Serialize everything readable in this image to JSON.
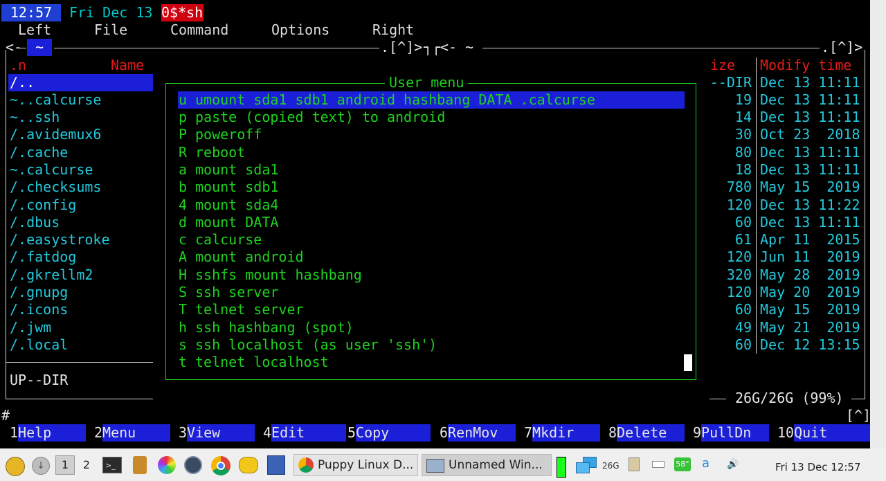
{
  "status": {
    "time": "12:57",
    "date": "Fri Dec 13",
    "session": "0$*sh"
  },
  "menubar": [
    "Left",
    "File",
    "Command",
    "Options",
    "Right"
  ],
  "left_panel": {
    "header_prefix": "<-",
    "path": "~",
    "top_right": ".[^]>",
    "col_n": ".n",
    "col_name": "Name",
    "files": [
      "/..",
      "~..calcurse",
      "~..ssh",
      "/.avidemux6",
      "/.cache",
      "~.calcurse",
      "/.checksums",
      "/.config",
      "/.dbus",
      "/.easystroke",
      "/.fatdog",
      "/.gkrellm2",
      "/.gnupg",
      "/.icons",
      "/.jwm",
      "/.local"
    ],
    "status": "UP--DIR"
  },
  "right_panel": {
    "header_left": "<- ~",
    "top_right": ".[^]>",
    "col_size": "ize",
    "col_modify": "Modify time",
    "rows": [
      {
        "size": "--DIR",
        "date": "Dec 13 11:11"
      },
      {
        "size": "19",
        "date": "Dec 13 11:11"
      },
      {
        "size": "14",
        "date": "Dec 13 11:11"
      },
      {
        "size": "30",
        "date": "Oct 23  2018"
      },
      {
        "size": "80",
        "date": "Dec 13 11:11"
      },
      {
        "size": "18",
        "date": "Dec 13 11:11"
      },
      {
        "size": "780",
        "date": "May 15  2019"
      },
      {
        "size": "120",
        "date": "Dec 13 11:22"
      },
      {
        "size": "60",
        "date": "Dec 13 11:11"
      },
      {
        "size": "61",
        "date": "Apr 11  2015"
      },
      {
        "size": "120",
        "date": "Jun 11  2019"
      },
      {
        "size": "320",
        "date": "May 28  2019"
      },
      {
        "size": "120",
        "date": "May 20  2019"
      },
      {
        "size": "60",
        "date": "May 15  2019"
      },
      {
        "size": "49",
        "date": "May 21  2019"
      },
      {
        "size": "60",
        "date": "Dec 12 13:15"
      }
    ],
    "disk": "26G/26G (99%)"
  },
  "user_menu": {
    "title": "User menu",
    "items": [
      {
        "key": "u",
        "label": "umount sda1 sdb1 android hashbang DATA .calcurse"
      },
      {
        "key": "p",
        "label": "paste (copied text) to android"
      },
      {
        "key": "P",
        "label": "poweroff"
      },
      {
        "key": "R",
        "label": "reboot"
      },
      {
        "key": "a",
        "label": "mount sda1"
      },
      {
        "key": "b",
        "label": "mount sdb1"
      },
      {
        "key": "4",
        "label": "mount sda4"
      },
      {
        "key": "d",
        "label": "mount DATA"
      },
      {
        "key": "c",
        "label": "calcurse"
      },
      {
        "key": "A",
        "label": "mount android"
      },
      {
        "key": "H",
        "label": "sshfs mount hashbang"
      },
      {
        "key": "S",
        "label": "ssh server"
      },
      {
        "key": "T",
        "label": "telnet server"
      },
      {
        "key": "h",
        "label": "ssh hashbang (spot)"
      },
      {
        "key": "s",
        "label": "ssh localhost (as user 'ssh')"
      },
      {
        "key": "t",
        "label": "telnet localhost"
      }
    ]
  },
  "prompt": "#",
  "prompt_hint": "[^]",
  "fkeys": [
    {
      "num": "1",
      "label": "Help"
    },
    {
      "num": "2",
      "label": "Menu"
    },
    {
      "num": "3",
      "label": "View"
    },
    {
      "num": "4",
      "label": "Edit"
    },
    {
      "num": "5",
      "label": "Copy"
    },
    {
      "num": "6",
      "label": "RenMov"
    },
    {
      "num": "7",
      "label": "Mkdir"
    },
    {
      "num": "8",
      "label": "Delete"
    },
    {
      "num": "9",
      "label": "PullDn"
    },
    {
      "num": "10",
      "label": "Quit"
    }
  ],
  "taskbar": {
    "desktops": [
      "1",
      "2"
    ],
    "windows": [
      "Puppy Linux D...",
      "Unnamed Win..."
    ],
    "disk_label": "26G",
    "temp": "58°",
    "kbd": "a",
    "clock": "Fri 13 Dec 12:57"
  }
}
